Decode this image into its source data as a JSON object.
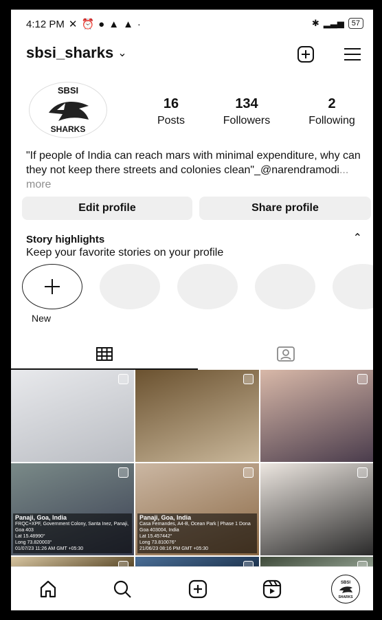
{
  "status_bar": {
    "time": "4:12 PM",
    "left_icons": [
      "no-mute-icon",
      "alarm-icon",
      "chat-bubble-icon",
      "bell-icon",
      "bell-icon",
      "dot-icon"
    ],
    "battery": "57"
  },
  "header": {
    "username": "sbsi_sharks",
    "username_chevron": "chevron-down-icon",
    "actions": [
      "add-post-icon",
      "menu-icon"
    ]
  },
  "profile": {
    "logo_top": "SBSI",
    "logo_bottom": "SHARKS",
    "stats": [
      {
        "num": "16",
        "label": "Posts"
      },
      {
        "num": "134",
        "label": "Followers"
      },
      {
        "num": "2",
        "label": "Following"
      }
    ],
    "bio_text": "\"If people of India can reach mars with minimal expenditure, why can they not keep there streets and colonies clean\"_@narendramodi",
    "bio_more": "... more",
    "edit_label": "Edit profile",
    "share_label": "Share profile"
  },
  "highlights": {
    "title": "Story highlights",
    "subtitle": "Keep your favorite stories on your profile",
    "new_label": "New",
    "placeholder_count": 4
  },
  "tabs": [
    "grid-icon",
    "tagged-icon"
  ],
  "grid": [
    {
      "name": "post-notebook",
      "colors": [
        "#e8e9ec",
        "#b9bcc2"
      ],
      "geo": false
    },
    {
      "name": "post-mushrooms",
      "colors": [
        "#6b5230",
        "#c9b79a"
      ],
      "geo": false
    },
    {
      "name": "post-child-playing",
      "colors": [
        "#d8b8a8",
        "#4a3c4c"
      ],
      "geo": false
    },
    {
      "name": "post-group-photo",
      "colors": [
        "#7a8a88",
        "#3a3f52"
      ],
      "geo": true,
      "geo_title": "Panaji, Goa, India",
      "geo_lines": [
        "FRQC+XPF, Government Colony, Santa Inez, Panaji, Goa 403",
        "Lat 15.48990°",
        "Long 73.820003°",
        "01/07/23 11:26 AM GMT +05:30"
      ]
    },
    {
      "name": "post-jute-bag",
      "colors": [
        "#cbb7a3",
        "#8a6844"
      ],
      "geo": true,
      "geo_title": "Panaji, Goa, India",
      "geo_lines": [
        "Casa Fernandes, A4-B, Ocean Park | Phase 1 Dona",
        "Goa 403004, India",
        "Lat 15.457442°",
        "Long 73.810076°",
        "21/06/23 08:16 PM GMT +05:30"
      ]
    },
    {
      "name": "post-black-dustbin",
      "colors": [
        "#ece6e0",
        "#2a2a2a"
      ],
      "geo": false
    },
    {
      "name": "post-row3-a",
      "colors": [
        "#d9c7a3",
        "#5b4a2a"
      ],
      "geo": false
    },
    {
      "name": "post-row3-b",
      "colors": [
        "#4a6e96",
        "#1f3550"
      ],
      "geo": false
    },
    {
      "name": "post-row3-c",
      "colors": [
        "#3f4a3a",
        "#8c9a8a"
      ],
      "geo": false
    }
  ],
  "nav": [
    "home-icon",
    "search-icon",
    "create-icon",
    "reels-icon",
    "profile-avatar-icon"
  ]
}
